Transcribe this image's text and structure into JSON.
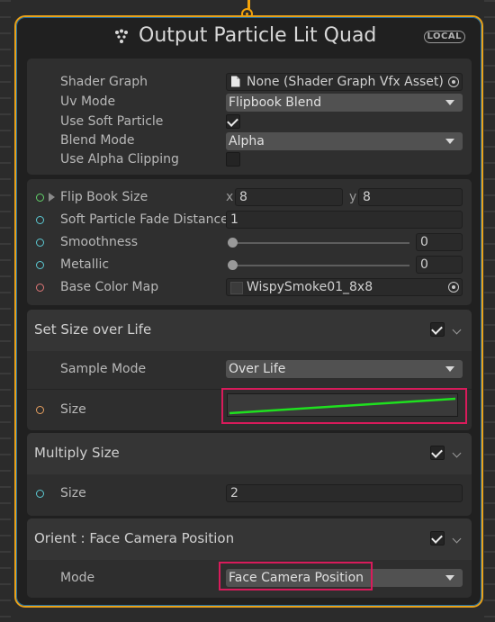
{
  "node": {
    "title": "Output Particle Lit Quad",
    "badge": "LOCAL"
  },
  "properties": {
    "shader_graph": {
      "label": "Shader Graph",
      "value": "None (Shader Graph Vfx Asset)"
    },
    "uv_mode": {
      "label": "Uv Mode",
      "value": "Flipbook Blend"
    },
    "use_soft_particle": {
      "label": "Use Soft Particle",
      "checked": true
    },
    "blend_mode": {
      "label": "Blend Mode",
      "value": "Alpha"
    },
    "use_alpha_clipping": {
      "label": "Use Alpha Clipping",
      "checked": false
    },
    "flip_book_size": {
      "label": "Flip Book Size",
      "x_label": "x",
      "x": "8",
      "y_label": "y",
      "y": "8"
    },
    "soft_particle_fade_distance": {
      "label": "Soft Particle Fade Distance",
      "value": "1"
    },
    "smoothness": {
      "label": "Smoothness",
      "value": "0",
      "level": 0
    },
    "metallic": {
      "label": "Metallic",
      "value": "0",
      "level": 0
    },
    "base_color_map": {
      "label": "Base Color Map",
      "value": "WispySmoke01_8x8"
    }
  },
  "blocks": [
    {
      "title": "Set Size over Life",
      "enabled": true,
      "sample_mode": {
        "label": "Sample Mode",
        "value": "Over Life"
      },
      "size": {
        "label": "Size",
        "curve_color": "#1fe01f"
      }
    },
    {
      "title": "Multiply Size",
      "enabled": true,
      "size": {
        "label": "Size",
        "value": "2"
      }
    },
    {
      "title": "Orient : Face Camera Position",
      "enabled": true,
      "mode": {
        "label": "Mode",
        "value": "Face Camera Position"
      }
    }
  ],
  "colors": {
    "node_border": "#e8a11a",
    "highlight": "#d81b5b",
    "port_green": "#62d16a",
    "port_cyan": "#5cc9d3",
    "port_salmon": "#e07777",
    "port_orange": "#e8a060"
  }
}
